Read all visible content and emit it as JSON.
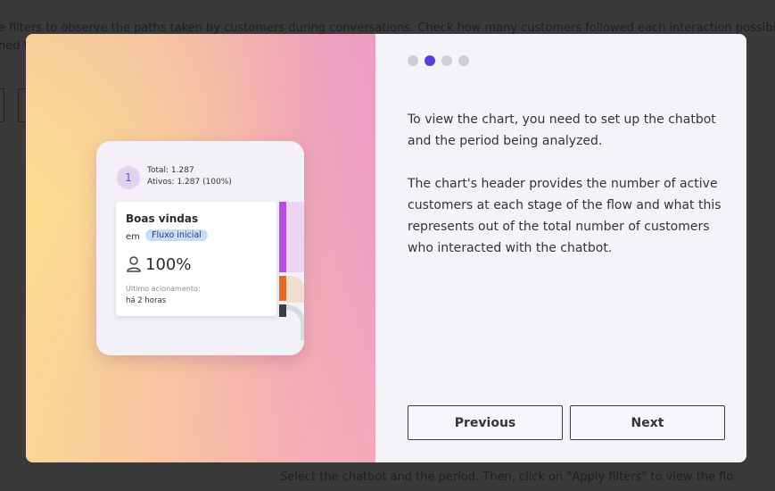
{
  "background": {
    "top_line": "e filters to observe the paths taken by customers during conversations. Check how many customers followed each interaction possibility",
    "top_line2": "ned t",
    "bottom_line": "Select the chatbot and the period. Then, click on \"Apply filters\" to view the flo"
  },
  "illustration": {
    "step_number": "1",
    "total": "Total: 1.287",
    "active": "Ativos: 1.287 (100%)",
    "node_title": "Boas vindas",
    "node_em": "em",
    "node_chip": "Fluxo inicial",
    "node_percent": "100%",
    "node_last_label": "Último acionamento:",
    "node_last_value": "há 2 horas",
    "colors": {
      "purple": "#b44ee0",
      "orange": "#e06a2b",
      "dark": "#3c3c48"
    }
  },
  "stepper": {
    "count": 4,
    "active_index": 1
  },
  "content": {
    "paragraph1": "To view the chart, you need to set up the chatbot and the period being analyzed.",
    "paragraph2": "The chart's header provides the number of active customers at each stage of the flow and what this represents out of the total number of customers who interacted with the chatbot."
  },
  "buttons": {
    "previous": "Previous",
    "next": "Next"
  }
}
